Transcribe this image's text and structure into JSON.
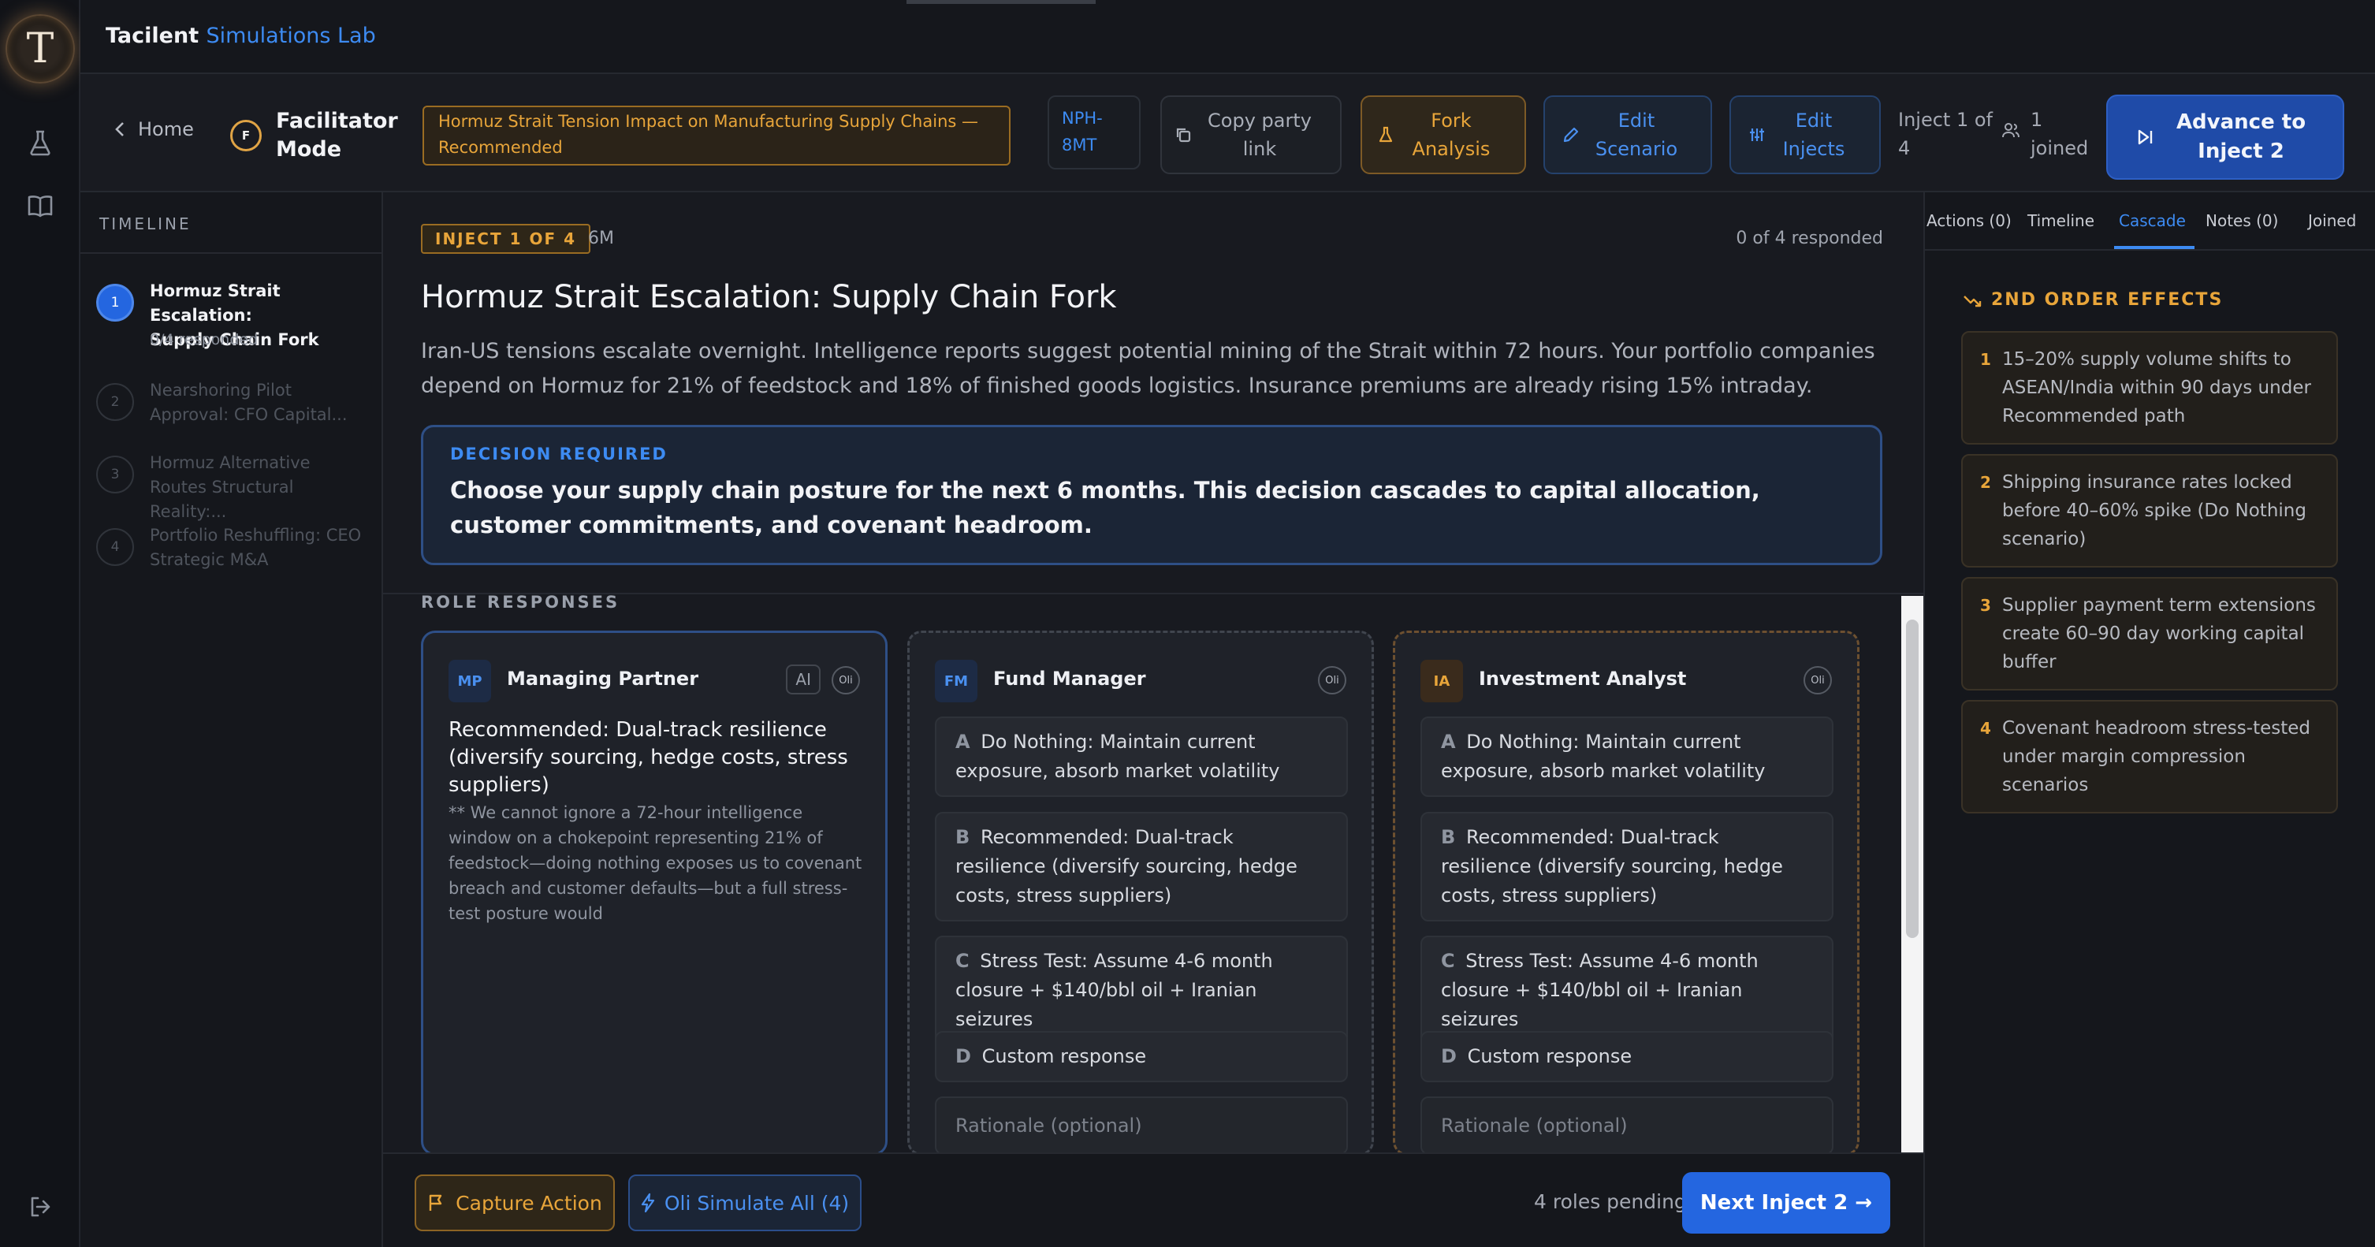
{
  "app": {
    "brand": "Tacilent",
    "brand_sub": "Simulations Lab",
    "logo_letter": "T"
  },
  "header": {
    "home": "Home",
    "mode_letter": "F",
    "mode_label_1": "Facilitator",
    "mode_label_2": "Mode",
    "scenario_1": "Hormuz Strait Tension Impact on Manufacturing Supply Chains —",
    "scenario_2": "Recommended",
    "code_1": "NPH-",
    "code_2": "8MT",
    "copy_1": "Copy party",
    "copy_2": "link",
    "fork_1": "Fork",
    "fork_2": "Analysis",
    "edit_scenario_1": "Edit",
    "edit_scenario_2": "Scenario",
    "edit_injects_1": "Edit",
    "edit_injects_2": "Injects",
    "inject_of_1": "Inject 1 of",
    "inject_of_2": "4",
    "joined_1": "1",
    "joined_2": "joined",
    "advance_1": "Advance to",
    "advance_2": "Inject 2"
  },
  "timeline": {
    "heading": "TIMELINE",
    "items": [
      {
        "num": "1",
        "title_1": "Hormuz Strait Escalation:",
        "title_2": "Supply Chain Fork",
        "sub": "0/4 responded"
      },
      {
        "num": "2",
        "title_1": "Nearshoring Pilot",
        "title_2": "Approval: CFO Capital..."
      },
      {
        "num": "3",
        "title_1": "Hormuz Alternative",
        "title_2": "Routes Structural Reality:..."
      },
      {
        "num": "4",
        "title_1": "Portfolio Reshuffling: CEO",
        "title_2": "Strategic M&A"
      }
    ]
  },
  "inject": {
    "badge": "INJECT 1 OF 4",
    "duration": "6M",
    "responded": "0 of 4 responded",
    "title": "Hormuz Strait Escalation: Supply Chain Fork",
    "description": "Iran-US tensions escalate overnight. Intelligence reports suggest potential mining of the Strait within 72 hours. Your portfolio companies depend on Hormuz for 21% of feedstock and 18% of finished goods logistics. Insurance premiums are already rising 15% intraday.",
    "decision_label": "DECISION REQUIRED",
    "decision_text": "Choose your supply chain posture for the next 6 months. This decision cascades to capital allocation, customer commitments, and covenant headroom."
  },
  "roles": {
    "heading": "ROLE RESPONSES",
    "oli_tag": "Oli",
    "ai_tag": "AI",
    "mp": {
      "initials": "MP",
      "name": "Managing Partner",
      "choice": "Recommended: Dual-track resilience (diversify sourcing, hedge costs, stress suppliers)",
      "rationale": "** We cannot ignore a 72-hour intelligence window on a chokepoint representing 21% of feedstock—doing nothing exposes us to covenant breach and customer defaults—but a full stress-test posture would"
    },
    "fm": {
      "initials": "FM",
      "name": "Fund Manager"
    },
    "ia": {
      "initials": "IA",
      "name": "Investment Analyst"
    },
    "options": [
      {
        "letter": "A",
        "text": "Do Nothing: Maintain current exposure, absorb market volatility"
      },
      {
        "letter": "B",
        "text": "Recommended: Dual-track resilience (diversify sourcing, hedge costs, stress suppliers)"
      },
      {
        "letter": "C",
        "text": "Stress Test: Assume 4-6 month closure + $140/bbl oil + Iranian seizures"
      },
      {
        "letter": "D",
        "text": "Custom response"
      }
    ],
    "rationale_placeholder": "Rationale (optional)"
  },
  "footer": {
    "capture": "Capture Action",
    "simulate": "Oli Simulate All (4)",
    "pending": "4 roles pending",
    "next": "Next Inject 2 →"
  },
  "right": {
    "tabs": [
      "Actions (0)",
      "Timeline",
      "Cascade",
      "Notes (0)",
      "Joined"
    ],
    "heading": "2ND ORDER EFFECTS",
    "effects": [
      {
        "num": "1",
        "text": "15–20% supply volume shifts to ASEAN/India within 90 days under Recommended path"
      },
      {
        "num": "2",
        "text": "Shipping insurance rates locked before 40–60% spike (Do Nothing scenario)"
      },
      {
        "num": "3",
        "text": "Supplier payment term extensions create 60–90 day working capital buffer"
      },
      {
        "num": "4",
        "text": "Covenant headroom stress-tested under margin compression scenarios"
      }
    ]
  },
  "colors": {
    "accent": "#3d8bf2",
    "amber": "#e8a53a",
    "background": "#16181e"
  }
}
